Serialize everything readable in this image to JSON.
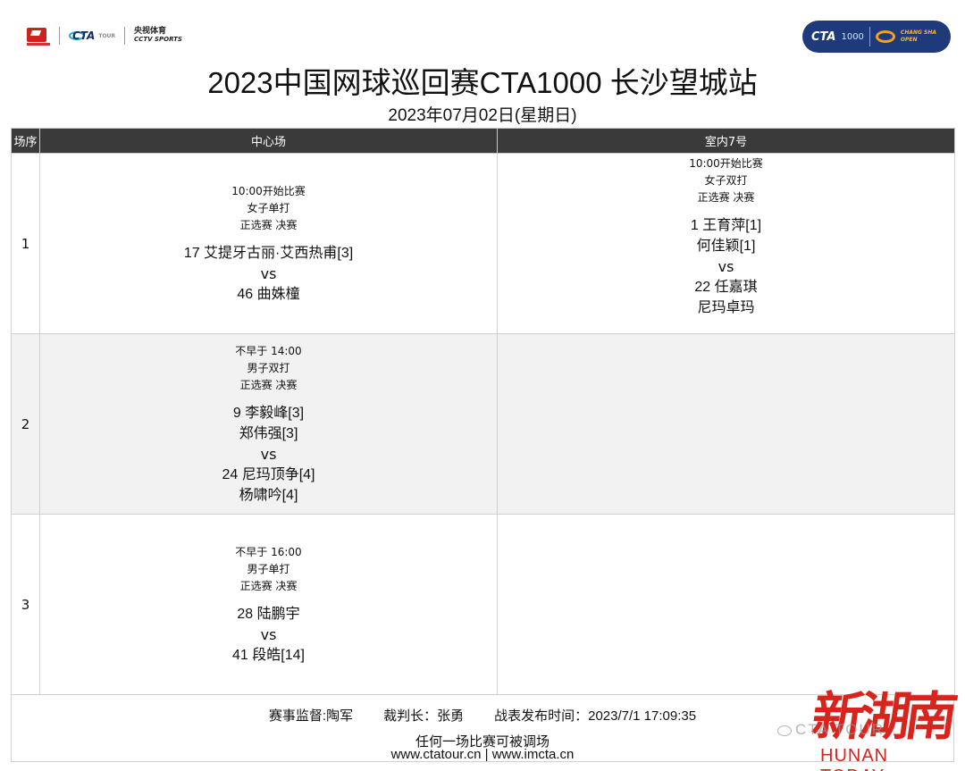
{
  "header": {
    "logos_left": [
      "china-tennis-association-logo",
      "cta-tour-logo",
      "cctv-sports-logo"
    ],
    "cctv_zh": "央视体育",
    "cctv_en": "CCTV SPORTS",
    "cta_small": "CTA",
    "cta_small_tour": "TOUR",
    "logo_right_cta": "CTA",
    "logo_right_1000": "1000",
    "logo_right_line1": "CHANG SHA",
    "logo_right_line2": "OPEN",
    "title": "2023中国网球巡回赛CTA1000 长沙望城站",
    "date": "2023年07月02日(星期日)"
  },
  "table": {
    "headers": [
      "场序",
      "中心场",
      "室内7号"
    ],
    "rows": [
      {
        "no": "1",
        "court_a": {
          "time": "10:00开始比赛",
          "event": "女子单打",
          "round": "正选赛 决赛",
          "side1": [
            "17  艾提牙古丽·艾西热甫[3]"
          ],
          "vs": "vs",
          "side2": [
            "46  曲姝橦"
          ]
        },
        "court_b": {
          "time": "10:00开始比赛",
          "event": "女子双打",
          "round": "正选赛 决赛",
          "side1": [
            "1  王育萍[1]",
            "何佳颖[1]"
          ],
          "vs": "vs",
          "side2": [
            "22  任嘉琪",
            "尼玛卓玛"
          ]
        }
      },
      {
        "no": "2",
        "court_a": {
          "time": "不早于 14:00",
          "event": "男子双打",
          "round": "正选赛 决赛",
          "side1": [
            "9  李毅峰[3]",
            "郑伟强[3]"
          ],
          "vs": "vs",
          "side2": [
            "24  尼玛顶争[4]",
            "杨啸吟[4]"
          ]
        }
      },
      {
        "no": "3",
        "court_a": {
          "time": "不早于 16:00",
          "event": "男子单打",
          "round": "正选赛 决赛",
          "side1": [
            "28  陆鹏宇"
          ],
          "vs": "vs",
          "side2": [
            "41  段皓[14]"
          ]
        }
      }
    ]
  },
  "footer": {
    "supervisor": "赛事监督:陶军",
    "referee": "裁判长：张勇",
    "published": "战表发布时间：2023/7/1 17:09:35",
    "note": "任何一场比赛可被调场",
    "urls": "www.ctatour.cn | www.imcta.cn"
  },
  "watermark": {
    "cn": "新湖南",
    "en": "HUNAN TODAY",
    "cta": "CTA TOUR"
  }
}
